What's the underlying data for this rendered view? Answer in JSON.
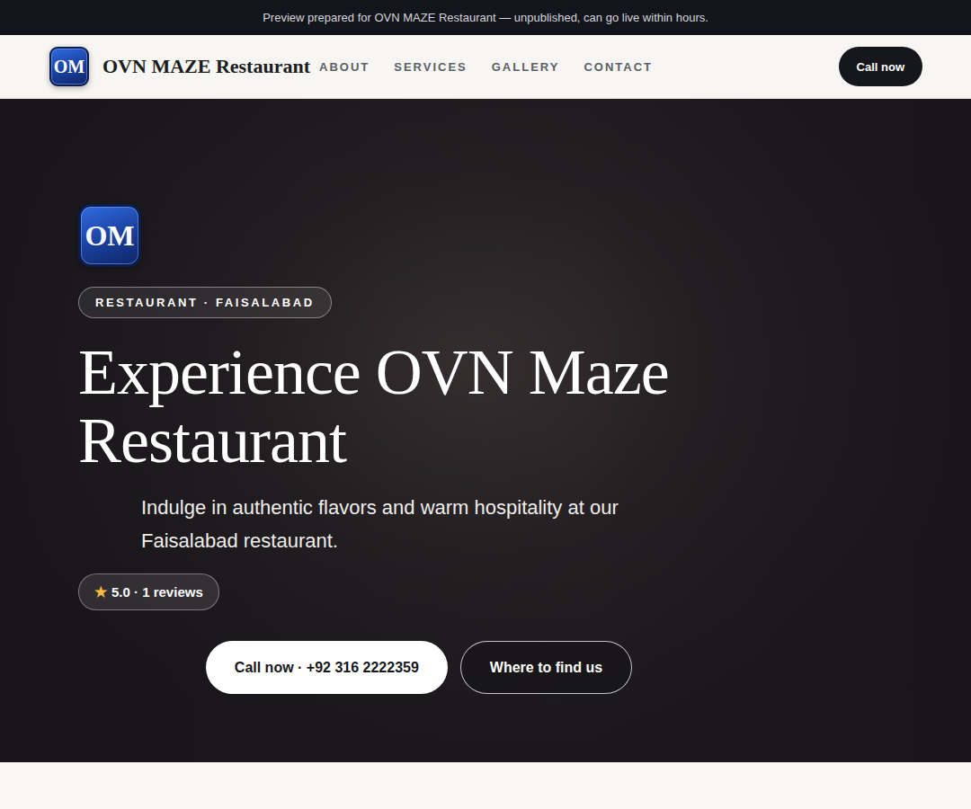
{
  "banner": {
    "text": "Preview prepared for OVN MAZE Restaurant — unpublished, can go live within hours."
  },
  "header": {
    "logo": "OM",
    "name": "OVN MAZE Restaurant",
    "nav": [
      {
        "label": "ABOUT"
      },
      {
        "label": "SERVICES"
      },
      {
        "label": "GALLERY"
      },
      {
        "label": "CONTACT"
      }
    ],
    "cta": "Call now"
  },
  "hero": {
    "logo": "OM",
    "tag": "RESTAURANT · FAISALABAD",
    "title": "Experience OVN Maze Restaurant",
    "subtitle": "Indulge in authentic flavors and warm hospitality at our Faisalabad restaurant.",
    "rating": {
      "star": "★",
      "text": "5.0 · 1 reviews"
    },
    "buttons": [
      {
        "label": "Call now · +92 316 2222359",
        "kind": "primary"
      },
      {
        "label": "Where to find us",
        "kind": "outline"
      }
    ]
  }
}
